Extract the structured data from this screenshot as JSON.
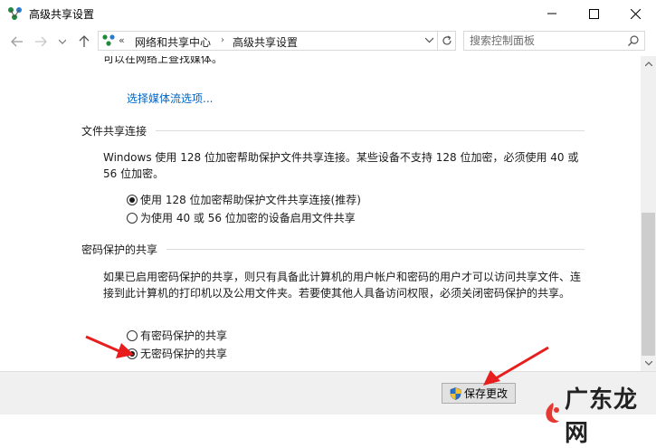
{
  "window": {
    "title": "高级共享设置"
  },
  "address": {
    "overflow": "«",
    "crumbs": [
      "网络和共享中心",
      "高级共享设置"
    ]
  },
  "search": {
    "placeholder": "搜索控制面板"
  },
  "content": {
    "partial_text": "可以在网络上查找媒体。",
    "media_link": "选择媒体流选项...",
    "file_sharing": {
      "heading": "文件共享连接",
      "description": "Windows 使用 128 位加密帮助保护文件共享连接。某些设备不支持 128 位加密，必须使用 40 或 56 位加密。",
      "options": [
        {
          "label": "使用 128 位加密帮助保护文件共享连接(推荐)",
          "checked": true
        },
        {
          "label": "为使用 40 或 56 位加密的设备启用文件共享",
          "checked": false
        }
      ]
    },
    "password_sharing": {
      "heading": "密码保护的共享",
      "description": "如果已启用密码保护的共享，则只有具备此计算机的用户帐户和密码的用户才可以访问共享文件、连接到此计算机的打印机以及公用文件夹。若要使其他人具备访问权限，必须关闭密码保护的共享。",
      "options": [
        {
          "label": "有密码保护的共享",
          "checked": false
        },
        {
          "label": "无密码保护的共享",
          "checked": true
        }
      ]
    }
  },
  "footer": {
    "save_label": "保存更改",
    "watermark": "广东龙网"
  },
  "colors": {
    "link": "#0066cc",
    "annotation_arrow": "#e81e1e",
    "watermark_icon": "#e53935"
  }
}
